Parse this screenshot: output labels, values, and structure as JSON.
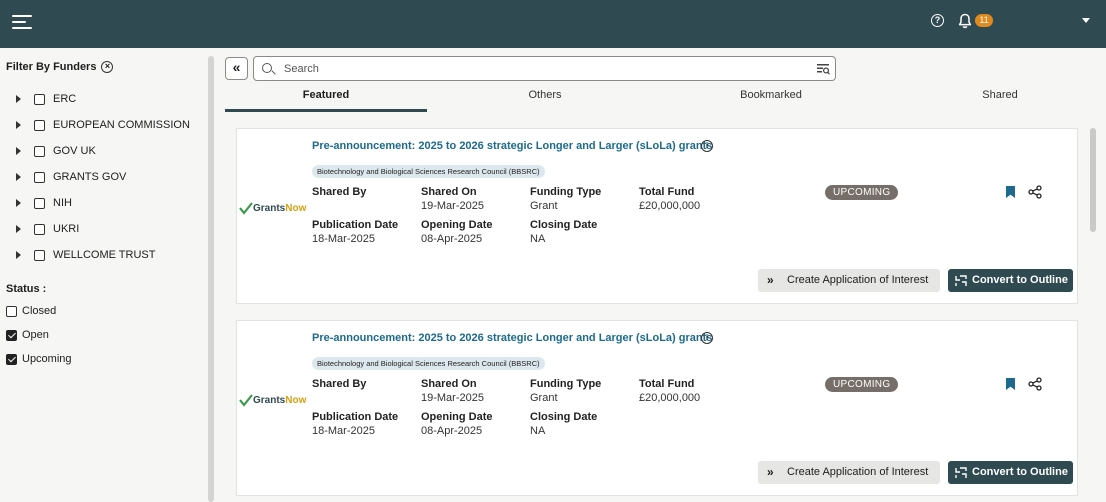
{
  "topbar": {
    "menu_icon": "hamburger-menu-icon",
    "help_icon": "help-circle-icon",
    "notification_icon": "bell-icon",
    "notification_count": "11",
    "help_glyph": "?"
  },
  "sidebar": {
    "filter_title": "Filter By Funders",
    "clear_glyph": "×",
    "funders": [
      {
        "label": "ERC",
        "checked": false
      },
      {
        "label": "EUROPEAN COMMISSION",
        "checked": false
      },
      {
        "label": "GOV UK",
        "checked": false
      },
      {
        "label": "GRANTS GOV",
        "checked": false
      },
      {
        "label": "NIH",
        "checked": false
      },
      {
        "label": "UKRI",
        "checked": false
      },
      {
        "label": "WELLCOME TRUST",
        "checked": false
      }
    ],
    "status_title": "Status :",
    "statuses": [
      {
        "label": "Closed",
        "checked": false
      },
      {
        "label": "Open",
        "checked": true
      },
      {
        "label": "Upcoming",
        "checked": true
      }
    ]
  },
  "toolbar": {
    "collapse_glyph": "«",
    "search_placeholder": "Search"
  },
  "tabs": [
    {
      "label": "Featured",
      "active": true
    },
    {
      "label": "Others",
      "active": false
    },
    {
      "label": "Bookmarked",
      "active": false
    },
    {
      "label": "Shared",
      "active": false
    }
  ],
  "logo": {
    "part1": "Grants",
    "part2": "Now"
  },
  "cards": [
    {
      "title": "Pre-announcement: 2025 to 2026 strategic Longer and Larger (sLoLa) grants",
      "council": "Biotechnology and Biological Sciences Research Council (BBSRC)",
      "shared_by_label": "Shared By",
      "shared_by": "",
      "shared_on_label": "Shared On",
      "shared_on": "19-Mar-2025",
      "funding_type_label": "Funding Type",
      "funding_type": "Grant",
      "total_fund_label": "Total Fund",
      "total_fund": "£20,000,000",
      "publication_date_label": "Publication Date",
      "publication_date": "18-Mar-2025",
      "opening_date_label": "Opening Date",
      "opening_date": "08-Apr-2025",
      "closing_date_label": "Closing Date",
      "closing_date": "NA",
      "status": "UPCOMING",
      "aoi_button": "Create Application of Interest",
      "outline_button": "Convert to Outline"
    },
    {
      "title": "Pre-announcement: 2025 to 2026 strategic Longer and Larger (sLoLa) grants",
      "council": "Biotechnology and Biological Sciences Research Council (BBSRC)",
      "shared_by_label": "Shared By",
      "shared_by": "",
      "shared_on_label": "Shared On",
      "shared_on": "19-Mar-2025",
      "funding_type_label": "Funding Type",
      "funding_type": "Grant",
      "total_fund_label": "Total Fund",
      "total_fund": "£20,000,000",
      "publication_date_label": "Publication Date",
      "publication_date": "18-Mar-2025",
      "opening_date_label": "Opening Date",
      "opening_date": "08-Apr-2025",
      "closing_date_label": "Closing Date",
      "closing_date": "NA",
      "status": "UPCOMING",
      "aoi_button": "Create Application of Interest",
      "outline_button": "Convert to Outline"
    }
  ],
  "colors": {
    "topbar": "#2f4a50",
    "link": "#1c6b8f",
    "badge": "#e08a1e",
    "status_badge": "#766e68"
  }
}
